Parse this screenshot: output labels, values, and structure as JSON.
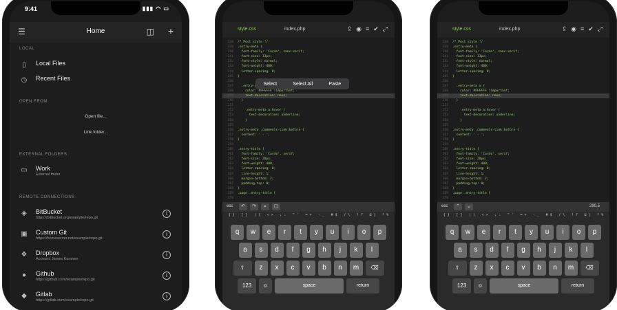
{
  "phone1": {
    "status_time": "9:41",
    "header": {
      "title": "Home",
      "left_icon": "sliders-icon",
      "split_icon": "split-view-icon",
      "add_icon": "plus-icon"
    },
    "local": {
      "label": "LOCAL",
      "items": [
        {
          "icon": "phone-icon",
          "title": "Local Files"
        },
        {
          "icon": "clock-icon",
          "title": "Recent Files"
        }
      ]
    },
    "open_from": {
      "label": "OPEN FROM",
      "links": [
        "Open file...",
        "Link folder..."
      ]
    },
    "external": {
      "label": "EXTERNAL FOLDERS",
      "items": [
        {
          "icon": "folder-icon",
          "title": "Work",
          "subtitle": "External folder"
        }
      ]
    },
    "remote": {
      "label": "REMOTE CONNECTIONS",
      "items": [
        {
          "icon": "bitbucket-icon",
          "title": "BitBucket",
          "subtitle": "https://bitbucket.org/example/repo.git"
        },
        {
          "icon": "git-icon",
          "title": "Custom Git",
          "subtitle": "https://homeserver.net/example/repo.git"
        },
        {
          "icon": "dropbox-icon",
          "title": "Dropbox",
          "subtitle": "Account: James Kuronen"
        },
        {
          "icon": "github-icon",
          "title": "Github",
          "subtitle": "https://github.com/example/repo.git"
        },
        {
          "icon": "gitlab-icon",
          "title": "Gitlab",
          "subtitle": "https://gitlab.com/example/repo.git"
        }
      ]
    }
  },
  "editor": {
    "tabs": [
      "style.css",
      "index.php"
    ],
    "context_menu": [
      "Select",
      "Select All",
      "Paste"
    ],
    "cursor_position": "290,5",
    "code_lines": [
      {
        "n": "238",
        "t": "/* Post style */"
      },
      {
        "n": "239",
        "t": ".entry-meta {"
      },
      {
        "n": "240",
        "t": "  font-family: 'Cardo', sans-serif;"
      },
      {
        "n": "241",
        "t": "  font-size: 13px;"
      },
      {
        "n": "242",
        "t": "  font-style: normal;"
      },
      {
        "n": "243",
        "t": "  font-weight: 400;"
      },
      {
        "n": "244",
        "t": "  letter-spacing: 0;"
      },
      {
        "n": "245",
        "t": "}"
      },
      {
        "n": "246",
        "t": ""
      },
      {
        "n": "247",
        "t": "  .entry-meta a {"
      },
      {
        "n": "248",
        "t": "    color: #FFFFFF !important;"
      },
      {
        "n": "249",
        "t": "    text-decoration: none;"
      },
      {
        "n": "250",
        "t": "  }"
      },
      {
        "n": "251",
        "t": ""
      },
      {
        "n": "252",
        "t": "    .entry-meta a:hover {"
      },
      {
        "n": "253",
        "t": "      text-decoration: underline;"
      },
      {
        "n": "254",
        "t": "    }"
      },
      {
        "n": "255",
        "t": ""
      },
      {
        "n": "256",
        "t": ".entry-meta .comments-link:before {"
      },
      {
        "n": "257",
        "t": "  content: ' - ';"
      },
      {
        "n": "258",
        "t": "}"
      },
      {
        "n": "259",
        "t": ""
      },
      {
        "n": "260",
        "t": ".entry-title {"
      },
      {
        "n": "261",
        "t": "  font-family: 'Cardo', serif;"
      },
      {
        "n": "262",
        "t": "  font-size: 28px;"
      },
      {
        "n": "263",
        "t": "  font-weight: 400;"
      },
      {
        "n": "264",
        "t": "  letter-spacing: 0;"
      },
      {
        "n": "265",
        "t": "  line-height: 1;"
      },
      {
        "n": "266",
        "t": "  margin-bottom: 2;"
      },
      {
        "n": "267",
        "t": "  padding-top: 0;"
      },
      {
        "n": "268",
        "t": "}"
      },
      {
        "n": "269",
        "t": ".page .entry-title {"
      },
      {
        "n": "270",
        "t": ""
      }
    ],
    "keyboard": {
      "esc": "esc",
      "row1": [
        "q",
        "w",
        "e",
        "r",
        "t",
        "y",
        "u",
        "i",
        "o",
        "p"
      ],
      "row2": [
        "a",
        "s",
        "d",
        "f",
        "g",
        "h",
        "j",
        "k",
        "l"
      ],
      "row3": [
        "z",
        "x",
        "c",
        "v",
        "b",
        "n",
        "m"
      ],
      "num": "123",
      "space": "space",
      "return": "return"
    }
  }
}
